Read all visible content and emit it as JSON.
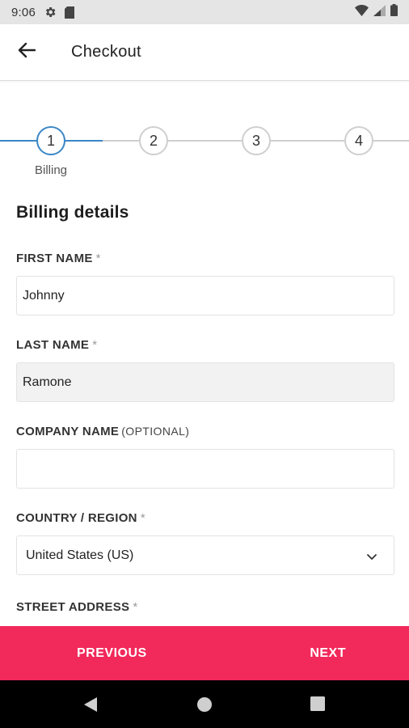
{
  "status_bar": {
    "time": "9:06",
    "icons": [
      "settings-gear-icon",
      "sd-card-icon",
      "wifi-icon",
      "signal-icon",
      "battery-icon"
    ]
  },
  "app_bar": {
    "back_icon": "arrow-left-icon",
    "title": "Checkout"
  },
  "stepper": {
    "steps": [
      {
        "number": "1",
        "label": "Billing",
        "active": true
      },
      {
        "number": "2",
        "label": "",
        "active": false
      },
      {
        "number": "3",
        "label": "",
        "active": false
      },
      {
        "number": "4",
        "label": "",
        "active": false
      }
    ],
    "active_color": "#3a87c6",
    "inactive_color": "#cfcfcf"
  },
  "form": {
    "section_title": "Billing details",
    "fields": {
      "first_name": {
        "label": "FIRST NAME",
        "required_mark": "*",
        "value": "Johnny"
      },
      "last_name": {
        "label": "LAST NAME",
        "required_mark": "*",
        "value": "Ramone"
      },
      "company_name": {
        "label": "COMPANY NAME",
        "optional_text": "(OPTIONAL)",
        "value": ""
      },
      "country": {
        "label": "COUNTRY / REGION",
        "required_mark": "*",
        "value": "United States (US)",
        "icon": "chevron-down-icon"
      },
      "street_address": {
        "label": "STREET ADDRESS",
        "required_mark": "*"
      }
    }
  },
  "actions": {
    "previous_label": "PREVIOUS",
    "next_label": "NEXT",
    "bar_color": "#f2295b"
  },
  "nav_bar": {
    "icons": [
      "back-triangle-icon",
      "home-circle-icon",
      "recents-square-icon"
    ]
  }
}
